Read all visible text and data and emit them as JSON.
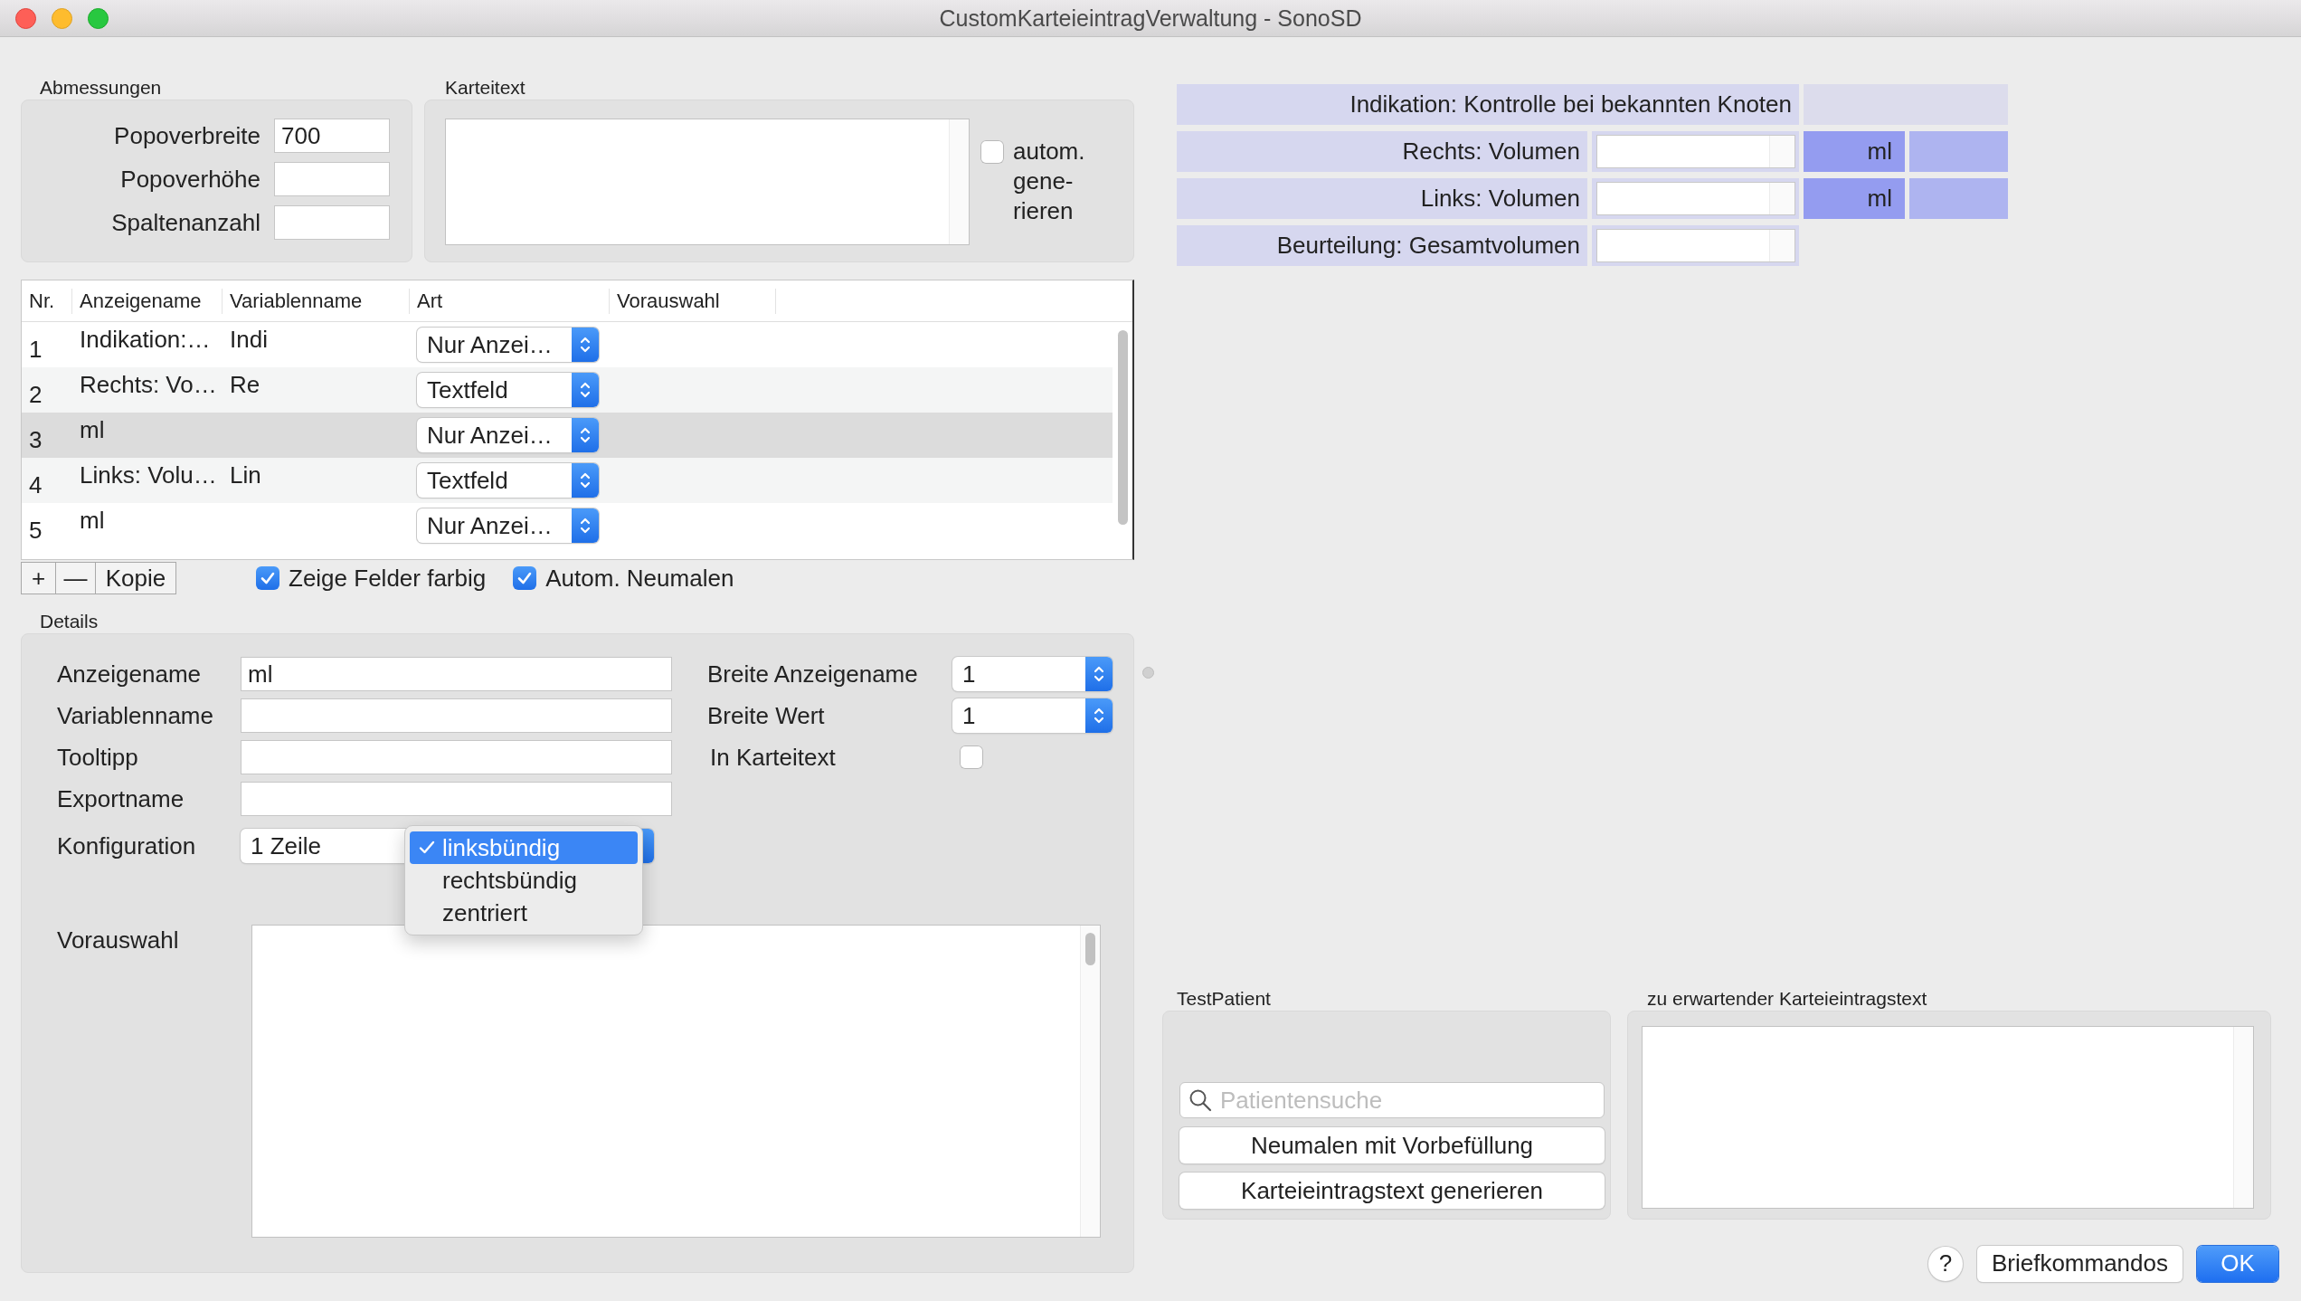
{
  "window": {
    "title": "CustomKarteieintragVerwaltung - SonoSD"
  },
  "abmessungen": {
    "title": "Abmessungen",
    "fields": [
      {
        "label": "Popoverbreite",
        "value": "700"
      },
      {
        "label": "Popoverhöhe"
      },
      {
        "label": "Spaltenanzahl"
      }
    ]
  },
  "karteitext": {
    "title": "Karteitext",
    "auto_generate": {
      "label": "autom. gene-rieren",
      "checked": false
    }
  },
  "table": {
    "columns": [
      "Nr.",
      "Anzeigename",
      "Variablenname",
      "Art",
      "Vorauswahl"
    ],
    "rows": [
      {
        "nr": "1",
        "anzeigename": "Indikation:…",
        "variablenname": "Indi",
        "art": "Nur Anzei…",
        "selected": false
      },
      {
        "nr": "2",
        "anzeigename": "Rechts: Vo…",
        "variablenname": "Re",
        "art": "Textfeld",
        "selected": false
      },
      {
        "nr": "3",
        "anzeigename": "ml",
        "art": "Nur Anzei…",
        "selected": true
      },
      {
        "nr": "4",
        "anzeigename": "Links: Volu…",
        "variablenname": "Lin",
        "art": "Textfeld",
        "selected": false
      },
      {
        "nr": "5",
        "anzeigename": "ml",
        "art": "Nur Anzei…",
        "selected": false
      }
    ]
  },
  "table_toolbar": {
    "buttons": [
      "+",
      "—",
      "Kopie"
    ],
    "options": [
      {
        "label": "Zeige Felder farbig",
        "checked": true
      },
      {
        "label": "Autom. Neumalen",
        "checked": true
      }
    ]
  },
  "details": {
    "title": "Details",
    "fields": [
      {
        "label": "Anzeigename",
        "value": "ml"
      },
      {
        "label": "Variablenname"
      },
      {
        "label": "Tooltipp"
      },
      {
        "label": "Exportname"
      }
    ],
    "konfiguration": {
      "label": "Konfiguration",
      "value": "1 Zeile",
      "menu": [
        {
          "label": "linksbündig",
          "selected": true
        },
        {
          "label": "rechtsbündig",
          "selected": false
        },
        {
          "label": "zentriert",
          "selected": false
        }
      ]
    },
    "settings": [
      {
        "kind": "popup",
        "label": "Breite Anzeigename",
        "value": "1"
      },
      {
        "kind": "popup",
        "label": "Breite Wert",
        "value": "1"
      },
      {
        "kind": "checkbox",
        "label": "In Karteitext",
        "checked": false
      }
    ],
    "vorauswahl": {
      "label": "Vorauswahl"
    }
  },
  "preview": {
    "rows": [
      {
        "kind": "heading",
        "label": "Indikation: Kontrolle bei bekannten Knoten"
      },
      {
        "kind": "field",
        "label": "Rechts: Volumen",
        "unit": "ml"
      },
      {
        "kind": "field",
        "label": "Links: Volumen",
        "unit": "ml"
      },
      {
        "kind": "field",
        "label": "Beurteilung: Gesamtvolumen"
      }
    ]
  },
  "test_patient": {
    "title": "TestPatient",
    "search": {
      "placeholder": "Patientensuche"
    },
    "buttons": [
      "Neumalen mit Vorbefüllung",
      "Karteieintragstext generieren"
    ]
  },
  "expected_text": {
    "title": "zu erwartender Karteieintragstext"
  },
  "footer": {
    "help": "?",
    "buttons": [
      {
        "label": "Briefkommandos",
        "default": false
      },
      {
        "label": "OK",
        "default": true
      }
    ]
  }
}
